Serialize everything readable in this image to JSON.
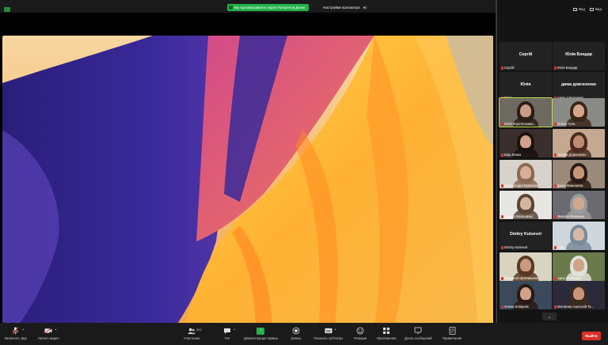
{
  "banner": {
    "share_notice": "Вы просматриваете экран Погорелов Денис",
    "view_options": "Настройки просмотра",
    "view_options_caret": "▾"
  },
  "panel": {
    "view_label": "Вид",
    "layout_label": "Вид",
    "scroll_glyph": "⌄"
  },
  "participants": [
    {
      "big": "Сергій",
      "name": "Сергій",
      "video": false
    },
    {
      "big": "Юлія Бондар",
      "name": "Юлія Бондар",
      "video": false
    },
    {
      "big": "Юлія",
      "name": "Юлія",
      "video": false
    },
    {
      "big": "дима довгаленко",
      "name": "дима довгаленко",
      "video": false
    },
    {
      "name": "Юлія Коротоныжка...",
      "video": true,
      "active": true,
      "bg": "#6e6a60",
      "skin": "#c99c85",
      "hair": "#2b1d18"
    },
    {
      "name": "Олеся Гула",
      "video": true,
      "bg": "#8a8a86",
      "skin": "#d6a58c",
      "hair": "#3a2619"
    },
    {
      "name": "Віра Левко",
      "video": true,
      "bg": "#3a2f2c",
      "skin": "#d0a08a",
      "hair": "#1a1210"
    },
    {
      "name": "Тетяна Дорошенко",
      "video": true,
      "bg": "#c4a890",
      "skin": "#c08a72",
      "hair": "#4a2a1e"
    },
    {
      "name": "Олександра Бурякова",
      "video": true,
      "bg": "#d8d2cc",
      "skin": "#d8b09a",
      "hair": "#8a6a52"
    },
    {
      "name": "Ірина Мамонкіна",
      "video": true,
      "bg": "#9a8a7a",
      "skin": "#c89478",
      "hair": "#2a1c14"
    },
    {
      "name": "лариса Мельничук",
      "video": true,
      "bg": "#e8e6e2",
      "skin": "#d2b4a0",
      "hair": "#5a4636"
    },
    {
      "name": "Микола Яковенко",
      "video": true,
      "bg": "#6a6a70",
      "skin": "#d0a88e",
      "hair": "#9a9a9a"
    },
    {
      "big": "Dmitry Kutsevol",
      "name": "Dmitry Kutsevol",
      "video": false
    },
    {
      "name": "Alya",
      "video": true,
      "bg": "#cfd6dc",
      "skin": "#d8b8a4",
      "hair": "#7a8a9a"
    },
    {
      "name": "Людмила Шевчишина",
      "video": true,
      "bg": "#d8d4c0",
      "skin": "#c89a80",
      "hair": "#5a3a22"
    },
    {
      "name": "Арна Оговладні",
      "video": true,
      "bg": "#6a7a4a",
      "skin": "#d0a486",
      "hair": "#e0e0d8"
    },
    {
      "name": "Олена Кобирнік",
      "video": true,
      "bg": "#3a4a5a",
      "skin": "#d0a28a",
      "hair": "#2a1a14"
    },
    {
      "name": "Матвенко Анатолій Тк...",
      "video": true,
      "bg": "#2a2a3a",
      "skin": "#c89478",
      "hair": "#3a2a20"
    }
  ],
  "toolbar": {
    "audio": "Включить звук",
    "video": "Начать видео",
    "participants": "Участники",
    "participants_count": "202",
    "chat": "Чат",
    "share": "Демонстрация экрана",
    "record": "Запись",
    "captions": "Показать субтитры",
    "reactions": "Реакции",
    "apps": "Приложения",
    "whiteboard": "Доска сообщений",
    "notes": "Примечания",
    "leave": "Выйти"
  },
  "icons": {
    "audio": "mic-muted-icon",
    "video": "camera-off-icon",
    "participants": "people-icon",
    "chat": "chat-bubble-icon",
    "share": "share-screen-icon",
    "record": "record-icon",
    "captions": "captions-icon",
    "reactions": "smiley-icon",
    "apps": "apps-icon",
    "whiteboard": "whiteboard-icon",
    "notes": "notes-icon"
  }
}
